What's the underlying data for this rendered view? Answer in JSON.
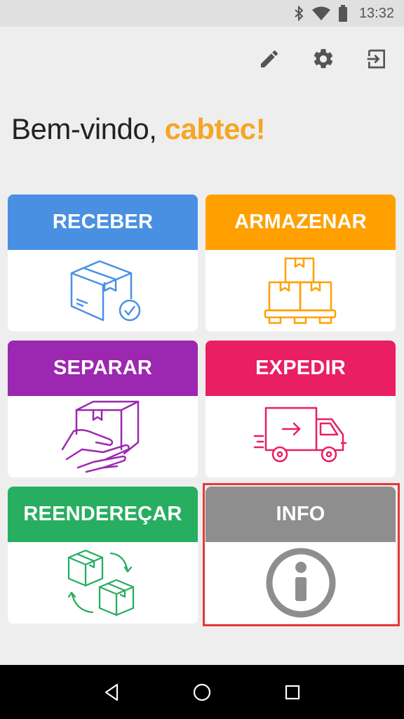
{
  "status_bar": {
    "time": "13:32",
    "icons": [
      "bluetooth-icon",
      "wifi-icon",
      "battery-icon"
    ]
  },
  "toolbar": {
    "icons": [
      "edit-icon",
      "settings-icon",
      "logout-icon"
    ]
  },
  "greeting": {
    "prefix": "Bem-vindo, ",
    "username": "cabtec!"
  },
  "tiles": [
    {
      "label": "RECEBER",
      "color": "#4a90e2",
      "icon": "receive-box-icon"
    },
    {
      "label": "ARMAZENAR",
      "color": "#ffa000",
      "icon": "store-boxes-icon"
    },
    {
      "label": "SEPARAR",
      "color": "#9c27b0",
      "icon": "pick-box-hand-icon"
    },
    {
      "label": "EXPEDIR",
      "color": "#e91e63",
      "icon": "delivery-truck-icon"
    },
    {
      "label": "REENDEREÇAR",
      "color": "#27ae60",
      "icon": "relocate-boxes-icon"
    },
    {
      "label": "INFO",
      "color": "#8e8e8e",
      "icon": "info-icon"
    }
  ],
  "highlight": {
    "color": "#e53935",
    "target": "INFO"
  },
  "nav_bar": {
    "icons": [
      "back-icon",
      "home-icon",
      "recents-icon"
    ]
  }
}
